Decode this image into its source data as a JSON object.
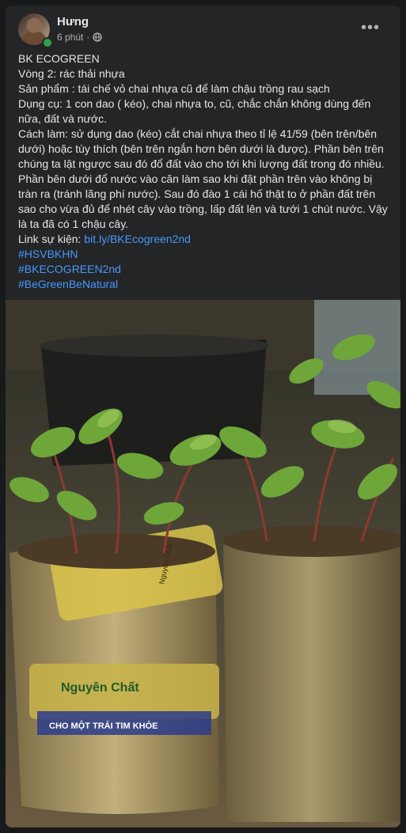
{
  "post": {
    "author": "Hưng",
    "time": "6 phút",
    "separator": "·",
    "privacy_icon": "globe-icon",
    "more_icon": "more-horizontal-icon",
    "more_label": "•••",
    "lines": {
      "title": "BK ECOGREEN",
      "round": "Vòng 2: rác thải nhựa",
      "product": "Sản phẩm : tái chế vỏ chai nhựa cũ để làm chậu trồng rau sạch",
      "tools": "Dụng cụ:  1 con dao ( kéo), chai nhựa to, cũ, chắc chắn không dùng đến nữa, đất và nước.",
      "method": "Cách làm: sử dụng dao (kéo) cắt chai nhựa theo tỉ lệ 41/59 (bên trên/bên dưới) hoặc tùy thích (bên trên ngắn hơn bên dưới là được). Phần bên trên chúng ta lật ngược sau đó đổ đất vào cho tới khi lượng đất trong đó nhiều. Phần bên dưới đổ nước vào căn làm sao khi đặt phần trên vào không bị tràn ra (tránh lãng phí nước). Sau đó đào 1 cái hố thật to ở phần đất trên sao cho vừa đủ để nhét cây vào trồng, lấp đất lên và tưới 1 chút nước. Vậy là ta đã có 1 chậu cây.",
      "link_prefix": "Link sự kiện: ",
      "link": "bit.ly/BKEcogreen2nd",
      "hashtags": [
        "#HSVBKHN",
        "#BKECOGREEN2nd",
        "#BeGreenBeNatural"
      ]
    },
    "image": {
      "label_text_1": "Nguyên Chất",
      "label_text_2": "CHO MỘT TRÁI TIM KHỎE",
      "label_text_3": "Nguyên Chất"
    }
  },
  "colors": {
    "background": "#18191a",
    "card": "#242526",
    "text": "#e4e6eb",
    "secondary_text": "#b0b3b8",
    "link": "#4599ff",
    "online": "#31a24c"
  }
}
